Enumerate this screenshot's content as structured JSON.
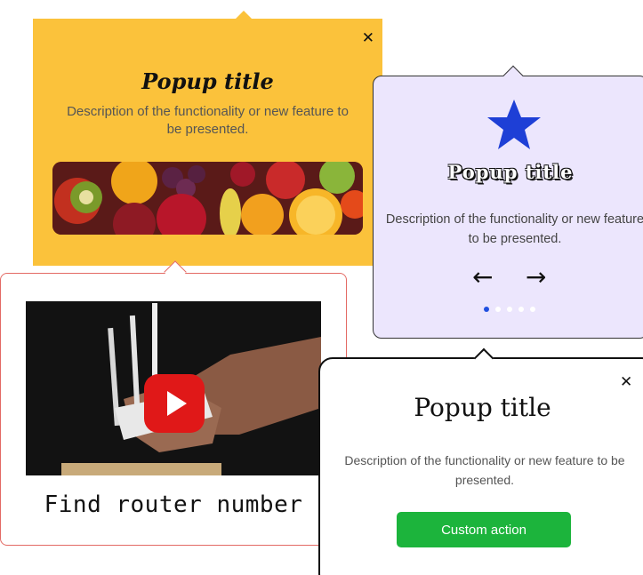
{
  "popup_yellow": {
    "close_icon": "close-icon",
    "close_glyph": "✕",
    "title": "Popup title",
    "description": "Description of the functionality or new feature to be presented.",
    "image": "fruit-image",
    "background": "#fbc23b"
  },
  "popup_video": {
    "play_icon": "play-icon",
    "caption": "Find router number",
    "border_color": "#e36a64",
    "play_color": "#e01818"
  },
  "popup_carousel": {
    "star_icon": "star-icon",
    "star_color": "#1e3fd6",
    "title": "Popup title",
    "description": "Description of the functionality or new feature to be presented.",
    "prev_arrow": "←",
    "next_arrow": "→",
    "dots": [
      {
        "active": true
      },
      {
        "active": false
      },
      {
        "active": false
      },
      {
        "active": false
      },
      {
        "active": false
      }
    ],
    "background": "#ece6fd"
  },
  "popup_action": {
    "close_glyph": "✕",
    "title": "Popup title",
    "description": "Description of the functionality or new feature to be presented.",
    "action_label": "Custom action",
    "action_color": "#1cb43c"
  }
}
